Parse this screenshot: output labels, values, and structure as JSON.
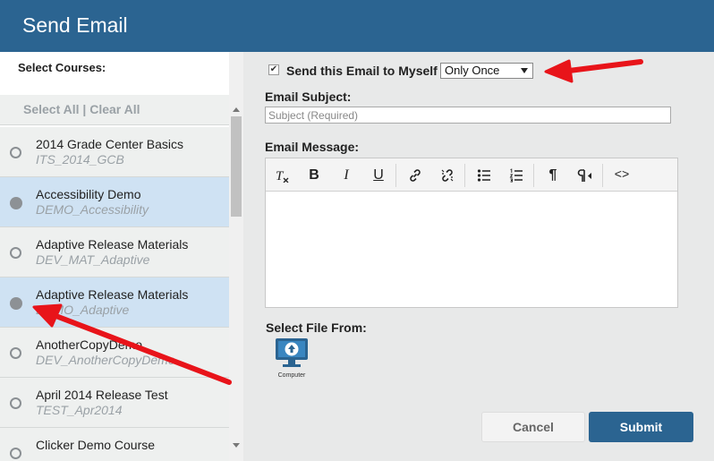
{
  "window": {
    "title": "Send Email"
  },
  "courses_panel": {
    "label": "Select Courses:",
    "select_all": "Select All",
    "separator": "|",
    "clear_all": "Clear All",
    "items": [
      {
        "name": "2014 Grade Center Basics",
        "code": "ITS_2014_GCB",
        "selected": false
      },
      {
        "name": "Accessibility Demo",
        "code": "DEMO_Accessibility",
        "selected": true
      },
      {
        "name": "Adaptive Release Materials",
        "code": "DEV_MAT_Adaptive",
        "selected": false
      },
      {
        "name": "Adaptive Release Materials",
        "code": "DEMO_Adaptive",
        "selected": true
      },
      {
        "name": "AnotherCopyDemo",
        "code": "DEV_AnotherCopyDemo",
        "selected": false
      },
      {
        "name": "April 2014 Release Test",
        "code": "TEST_Apr2014",
        "selected": false
      },
      {
        "name": "Clicker Demo Course",
        "code": "",
        "selected": false
      }
    ]
  },
  "form": {
    "send_to_myself_label": "Send this Email to Myself",
    "send_to_myself_checked": true,
    "checkmark": "✔",
    "frequency_value": "Only Once",
    "subject_label": "Email Subject:",
    "subject_placeholder": "Subject (Required)",
    "subject_value": "",
    "message_label": "Email Message:",
    "file_label": "Select File From:",
    "computer_caption": "Computer",
    "cancel_label": "Cancel",
    "submit_label": "Submit"
  },
  "toolbar_icons": [
    "clear-formatting-icon",
    "bold-icon",
    "italic-icon",
    "underline-icon",
    "link-icon",
    "unlink-icon",
    "bulleted-list-icon",
    "numbered-list-icon",
    "ltr-paragraph-icon",
    "rtl-paragraph-icon",
    "source-code-icon"
  ],
  "toolbar_glyphs": {
    "bold": "B",
    "italic": "I",
    "underline": "U",
    "ltr": "¶",
    "code": "<>"
  },
  "colors": {
    "header": "#2b6491",
    "selected_row": "#cfe2f3",
    "submit_button": "#2b6491",
    "annotation_arrow": "#e8141a"
  }
}
